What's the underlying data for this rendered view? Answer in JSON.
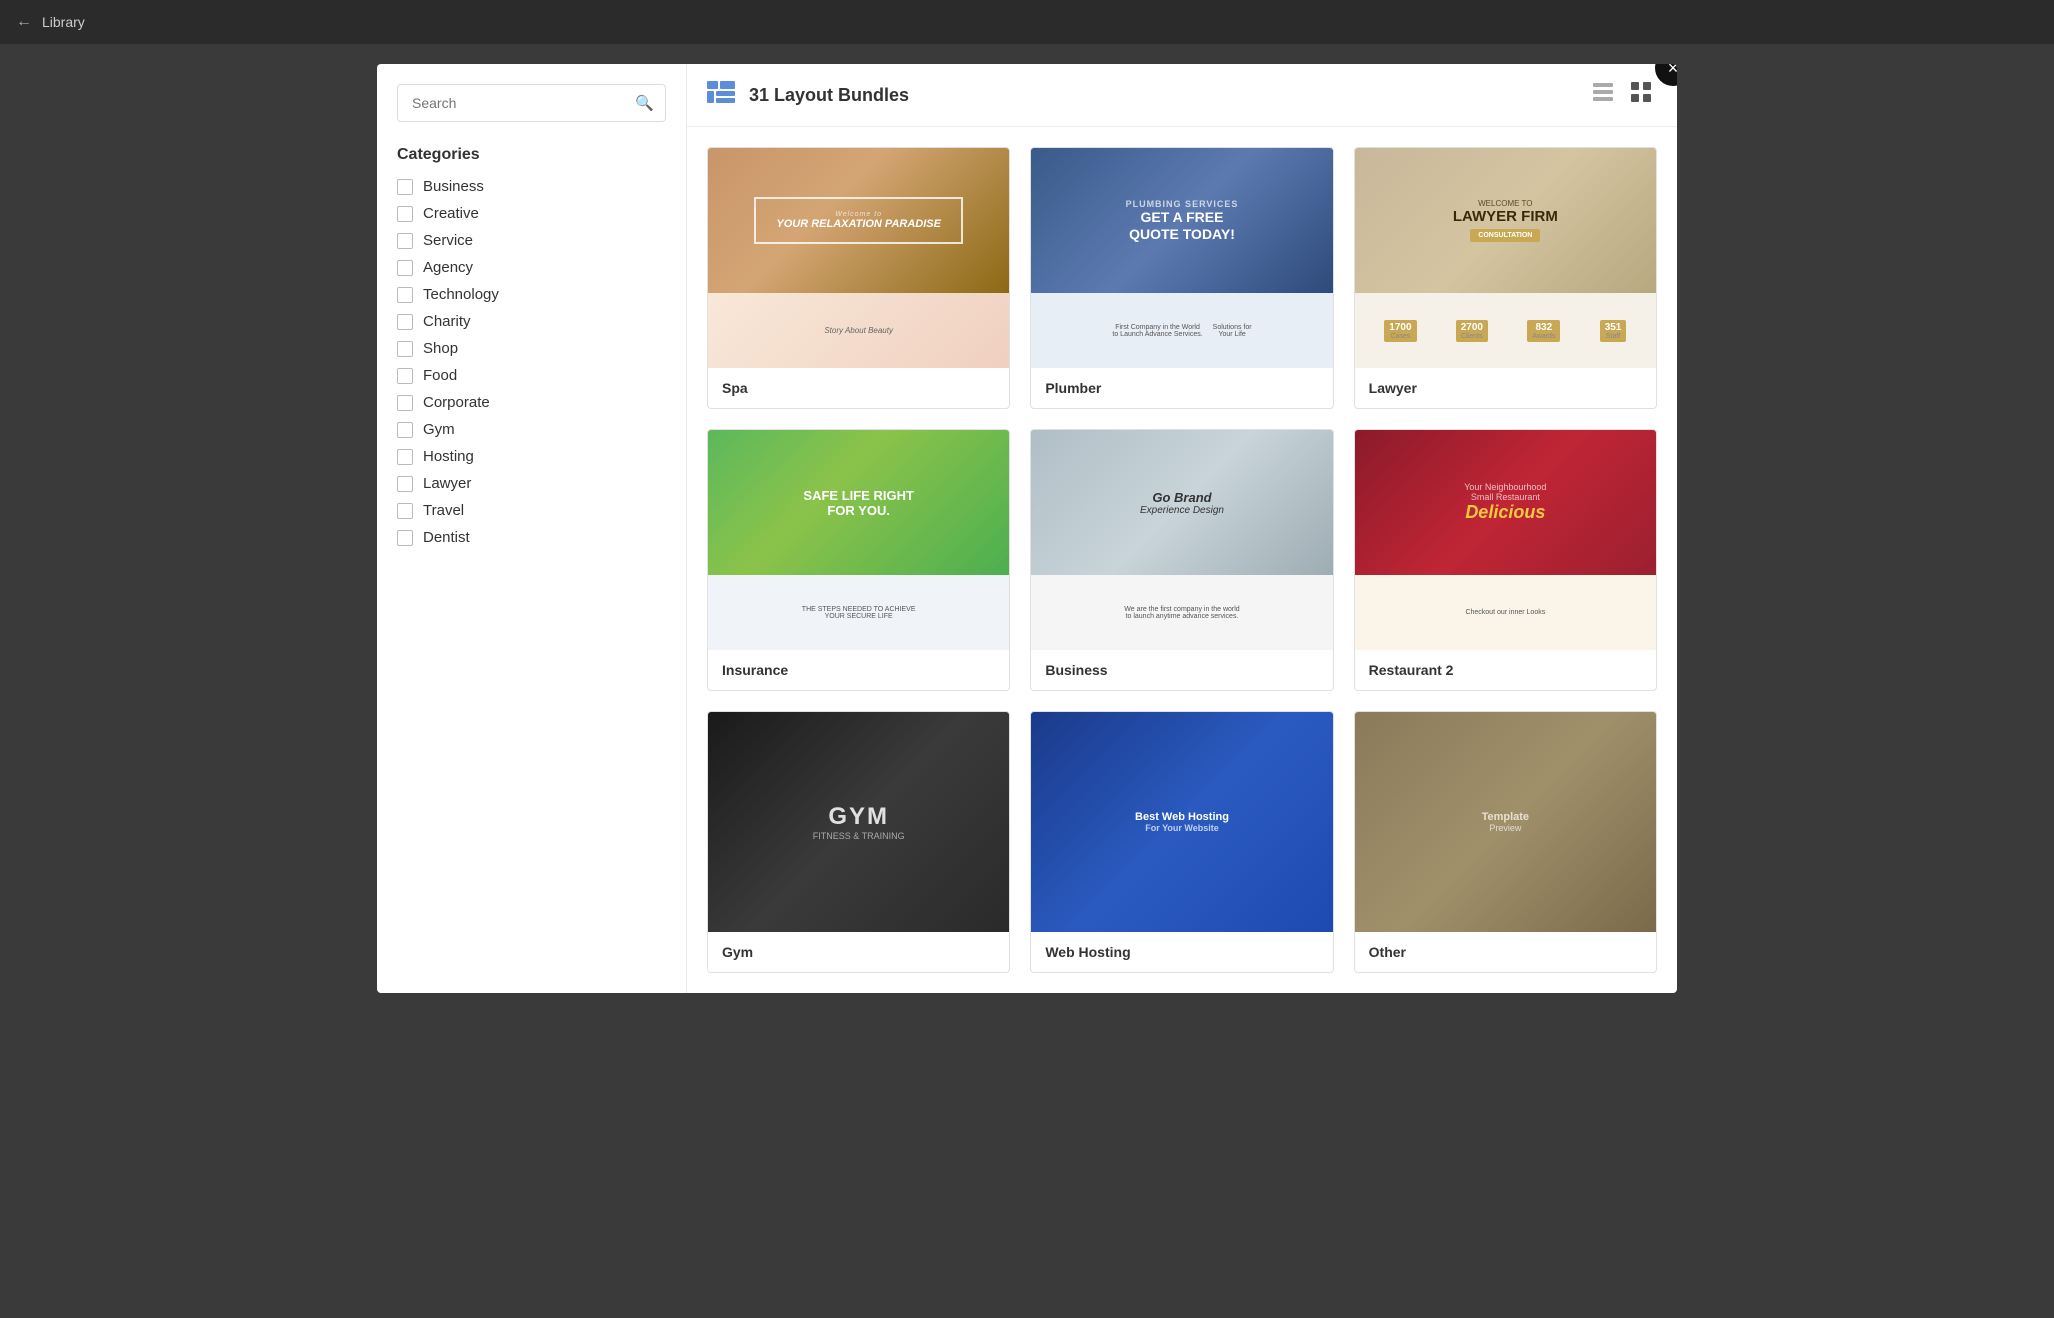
{
  "topBar": {
    "title": "Library",
    "backLabel": "←"
  },
  "modal": {
    "closeLabel": "×",
    "header": {
      "bundleCount": "31 Layout Bundles",
      "viewList": "☰",
      "viewGrid": "⊞"
    },
    "sidebar": {
      "searchPlaceholder": "Search",
      "categoriesTitle": "Categories",
      "categories": [
        {
          "id": "business",
          "label": "Business",
          "checked": false
        },
        {
          "id": "creative",
          "label": "Creative",
          "checked": false
        },
        {
          "id": "service",
          "label": "Service",
          "checked": false
        },
        {
          "id": "agency",
          "label": "Agency",
          "checked": false
        },
        {
          "id": "technology",
          "label": "Technology",
          "checked": false
        },
        {
          "id": "charity",
          "label": "Charity",
          "checked": false
        },
        {
          "id": "shop",
          "label": "Shop",
          "checked": false
        },
        {
          "id": "food",
          "label": "Food",
          "checked": false
        },
        {
          "id": "corporate",
          "label": "Corporate",
          "checked": false
        },
        {
          "id": "gym",
          "label": "Gym",
          "checked": false
        },
        {
          "id": "hosting",
          "label": "Hosting",
          "checked": false
        },
        {
          "id": "lawyer",
          "label": "Lawyer",
          "checked": false
        },
        {
          "id": "travel",
          "label": "Travel",
          "checked": false
        },
        {
          "id": "dentist",
          "label": "Dentist",
          "checked": false
        }
      ]
    },
    "templates": [
      {
        "id": "spa",
        "name": "Spa",
        "pro": false,
        "type": "spa"
      },
      {
        "id": "plumber",
        "name": "Plumber",
        "pro": false,
        "type": "plumber"
      },
      {
        "id": "lawyer",
        "name": "Lawyer",
        "pro": true,
        "type": "lawyer"
      },
      {
        "id": "insurance",
        "name": "Insurance",
        "pro": false,
        "type": "insurance"
      },
      {
        "id": "business",
        "name": "Business",
        "pro": true,
        "type": "business"
      },
      {
        "id": "restaurant2",
        "name": "Restaurant 2",
        "pro": true,
        "type": "restaurant2"
      },
      {
        "id": "gym",
        "name": "Gym",
        "pro": true,
        "type": "gym"
      },
      {
        "id": "hosting",
        "name": "Web Hosting",
        "pro": true,
        "type": "hosting"
      },
      {
        "id": "other",
        "name": "Other",
        "pro": true,
        "type": "other"
      }
    ]
  }
}
